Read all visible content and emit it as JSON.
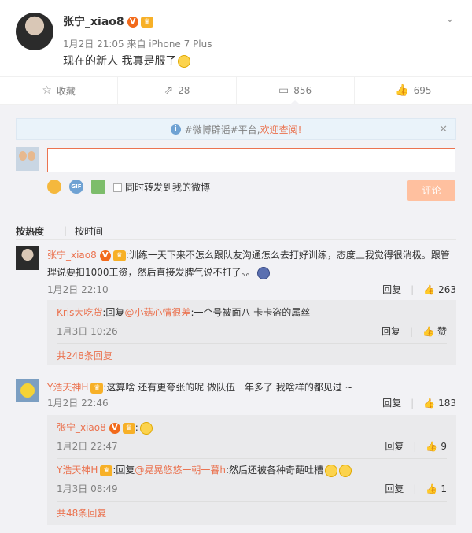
{
  "post": {
    "username": "张宁_xiao8",
    "meta": "1月2日 21:05 来自 iPhone 7 Plus",
    "text": "现在的新人 我真是服了"
  },
  "actions": [
    {
      "icon": "star-icon",
      "label": "收藏"
    },
    {
      "icon": "share-icon",
      "label": "28"
    },
    {
      "icon": "comment-icon",
      "label": "856"
    },
    {
      "icon": "thumbs-up-icon",
      "label": "695"
    }
  ],
  "notice": {
    "prefix": "#微博辟谣#平台,",
    "highlight": "欢迎查阅!"
  },
  "composer": {
    "forward_label": "同时转发到我的微博",
    "submit_label": "评论"
  },
  "sort": {
    "hot": "按热度",
    "time": "按时间"
  },
  "comments": [
    {
      "user": "张宁_xiao8",
      "text_line1": ":训练一天下来不怎么跟队友沟通怎么去打好训练，态度上我觉得很消极。跟管",
      "text_line2": "理说要扣1000工资，然后直接发脾气说不打了。。",
      "time": "1月2日 22:10",
      "reply_label": "回复",
      "likes": "263",
      "replies": [
        {
          "user": "Kris大吃货",
          "pre": ":回复",
          "mention": "@小菇心情很差",
          "text": ":一个号被面八 卡卡盗的属丝",
          "time": "1月3日 10:26",
          "reply_label": "回复",
          "likes": "赞"
        }
      ],
      "more": "共248条回复"
    },
    {
      "user": "Y浩天神H",
      "text_line1": ":这算啥 还有更夸张的呢 做队伍一年多了 我啥样的都见过 ~",
      "time": "1月2日 22:46",
      "reply_label": "回复",
      "likes": "183",
      "replies": [
        {
          "user": "张宁_xiao8",
          "pre": ":",
          "mention": "",
          "text": "",
          "time": "1月2日 22:47",
          "reply_label": "回复",
          "likes": "9"
        },
        {
          "user": "Y浩天神H",
          "pre": ":回复",
          "mention": "@晃晃悠悠一朝一暮h",
          "text": ":然后还被各种奇葩吐槽",
          "time": "1月3日 08:49",
          "reply_label": "回复",
          "likes": "1"
        }
      ],
      "more": "共48条回复"
    }
  ]
}
